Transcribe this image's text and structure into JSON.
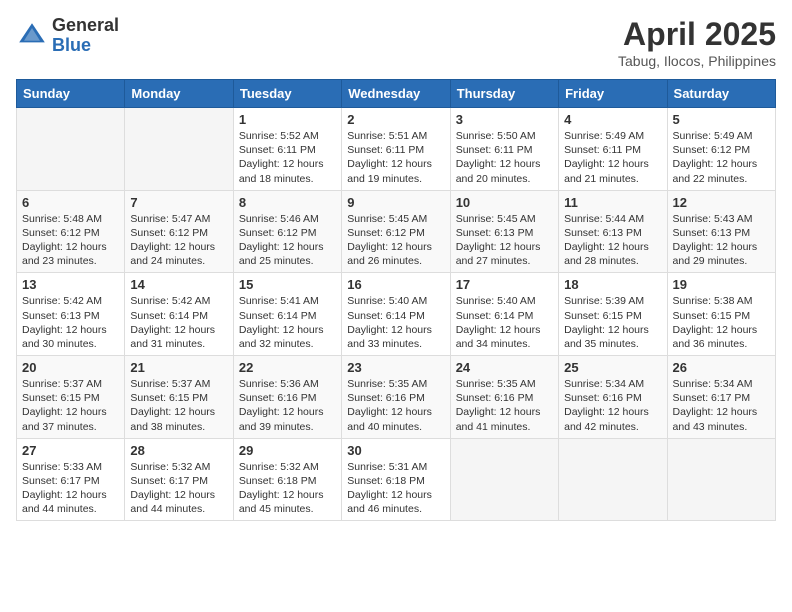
{
  "header": {
    "logo_general": "General",
    "logo_blue": "Blue",
    "month_year": "April 2025",
    "location": "Tabug, Ilocos, Philippines"
  },
  "days_of_week": [
    "Sunday",
    "Monday",
    "Tuesday",
    "Wednesday",
    "Thursday",
    "Friday",
    "Saturday"
  ],
  "weeks": [
    [
      {
        "day": "",
        "info": ""
      },
      {
        "day": "",
        "info": ""
      },
      {
        "day": "1",
        "info": "Sunrise: 5:52 AM\nSunset: 6:11 PM\nDaylight: 12 hours and 18 minutes."
      },
      {
        "day": "2",
        "info": "Sunrise: 5:51 AM\nSunset: 6:11 PM\nDaylight: 12 hours and 19 minutes."
      },
      {
        "day": "3",
        "info": "Sunrise: 5:50 AM\nSunset: 6:11 PM\nDaylight: 12 hours and 20 minutes."
      },
      {
        "day": "4",
        "info": "Sunrise: 5:49 AM\nSunset: 6:11 PM\nDaylight: 12 hours and 21 minutes."
      },
      {
        "day": "5",
        "info": "Sunrise: 5:49 AM\nSunset: 6:12 PM\nDaylight: 12 hours and 22 minutes."
      }
    ],
    [
      {
        "day": "6",
        "info": "Sunrise: 5:48 AM\nSunset: 6:12 PM\nDaylight: 12 hours and 23 minutes."
      },
      {
        "day": "7",
        "info": "Sunrise: 5:47 AM\nSunset: 6:12 PM\nDaylight: 12 hours and 24 minutes."
      },
      {
        "day": "8",
        "info": "Sunrise: 5:46 AM\nSunset: 6:12 PM\nDaylight: 12 hours and 25 minutes."
      },
      {
        "day": "9",
        "info": "Sunrise: 5:45 AM\nSunset: 6:12 PM\nDaylight: 12 hours and 26 minutes."
      },
      {
        "day": "10",
        "info": "Sunrise: 5:45 AM\nSunset: 6:13 PM\nDaylight: 12 hours and 27 minutes."
      },
      {
        "day": "11",
        "info": "Sunrise: 5:44 AM\nSunset: 6:13 PM\nDaylight: 12 hours and 28 minutes."
      },
      {
        "day": "12",
        "info": "Sunrise: 5:43 AM\nSunset: 6:13 PM\nDaylight: 12 hours and 29 minutes."
      }
    ],
    [
      {
        "day": "13",
        "info": "Sunrise: 5:42 AM\nSunset: 6:13 PM\nDaylight: 12 hours and 30 minutes."
      },
      {
        "day": "14",
        "info": "Sunrise: 5:42 AM\nSunset: 6:14 PM\nDaylight: 12 hours and 31 minutes."
      },
      {
        "day": "15",
        "info": "Sunrise: 5:41 AM\nSunset: 6:14 PM\nDaylight: 12 hours and 32 minutes."
      },
      {
        "day": "16",
        "info": "Sunrise: 5:40 AM\nSunset: 6:14 PM\nDaylight: 12 hours and 33 minutes."
      },
      {
        "day": "17",
        "info": "Sunrise: 5:40 AM\nSunset: 6:14 PM\nDaylight: 12 hours and 34 minutes."
      },
      {
        "day": "18",
        "info": "Sunrise: 5:39 AM\nSunset: 6:15 PM\nDaylight: 12 hours and 35 minutes."
      },
      {
        "day": "19",
        "info": "Sunrise: 5:38 AM\nSunset: 6:15 PM\nDaylight: 12 hours and 36 minutes."
      }
    ],
    [
      {
        "day": "20",
        "info": "Sunrise: 5:37 AM\nSunset: 6:15 PM\nDaylight: 12 hours and 37 minutes."
      },
      {
        "day": "21",
        "info": "Sunrise: 5:37 AM\nSunset: 6:15 PM\nDaylight: 12 hours and 38 minutes."
      },
      {
        "day": "22",
        "info": "Sunrise: 5:36 AM\nSunset: 6:16 PM\nDaylight: 12 hours and 39 minutes."
      },
      {
        "day": "23",
        "info": "Sunrise: 5:35 AM\nSunset: 6:16 PM\nDaylight: 12 hours and 40 minutes."
      },
      {
        "day": "24",
        "info": "Sunrise: 5:35 AM\nSunset: 6:16 PM\nDaylight: 12 hours and 41 minutes."
      },
      {
        "day": "25",
        "info": "Sunrise: 5:34 AM\nSunset: 6:16 PM\nDaylight: 12 hours and 42 minutes."
      },
      {
        "day": "26",
        "info": "Sunrise: 5:34 AM\nSunset: 6:17 PM\nDaylight: 12 hours and 43 minutes."
      }
    ],
    [
      {
        "day": "27",
        "info": "Sunrise: 5:33 AM\nSunset: 6:17 PM\nDaylight: 12 hours and 44 minutes."
      },
      {
        "day": "28",
        "info": "Sunrise: 5:32 AM\nSunset: 6:17 PM\nDaylight: 12 hours and 44 minutes."
      },
      {
        "day": "29",
        "info": "Sunrise: 5:32 AM\nSunset: 6:18 PM\nDaylight: 12 hours and 45 minutes."
      },
      {
        "day": "30",
        "info": "Sunrise: 5:31 AM\nSunset: 6:18 PM\nDaylight: 12 hours and 46 minutes."
      },
      {
        "day": "",
        "info": ""
      },
      {
        "day": "",
        "info": ""
      },
      {
        "day": "",
        "info": ""
      }
    ]
  ]
}
